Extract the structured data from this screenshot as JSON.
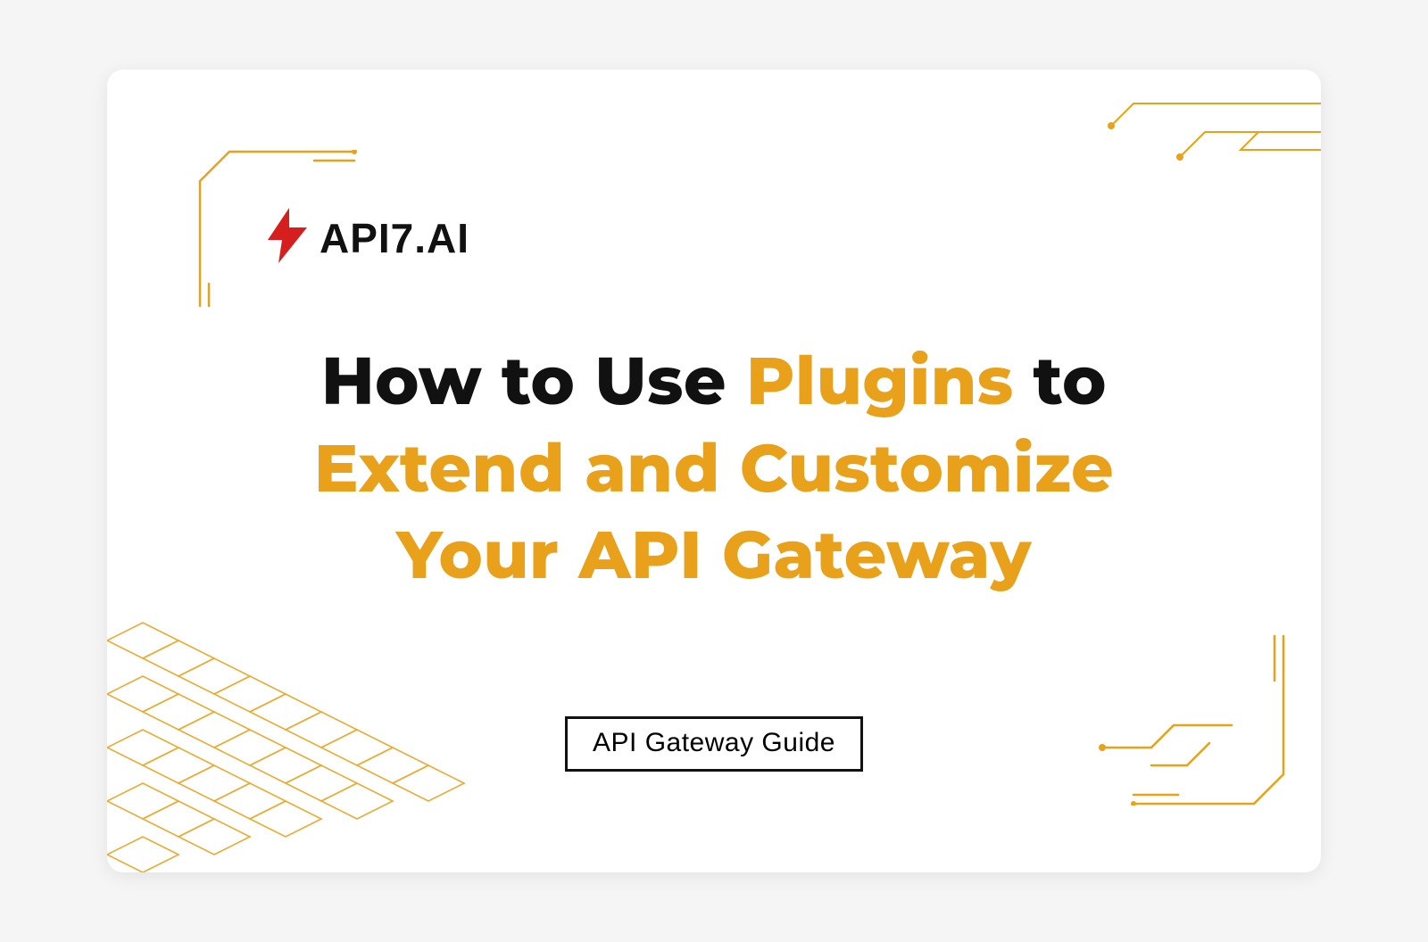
{
  "logo": {
    "text": "aPI7.aI"
  },
  "headline": {
    "part1": "How to Use ",
    "accent1": "Plugins",
    "part2": " to ",
    "accent2": "Extend and Customize Your API Gateway"
  },
  "badge": {
    "label": "API Gateway Guide"
  },
  "colors": {
    "accent": "#E9A11B"
  }
}
